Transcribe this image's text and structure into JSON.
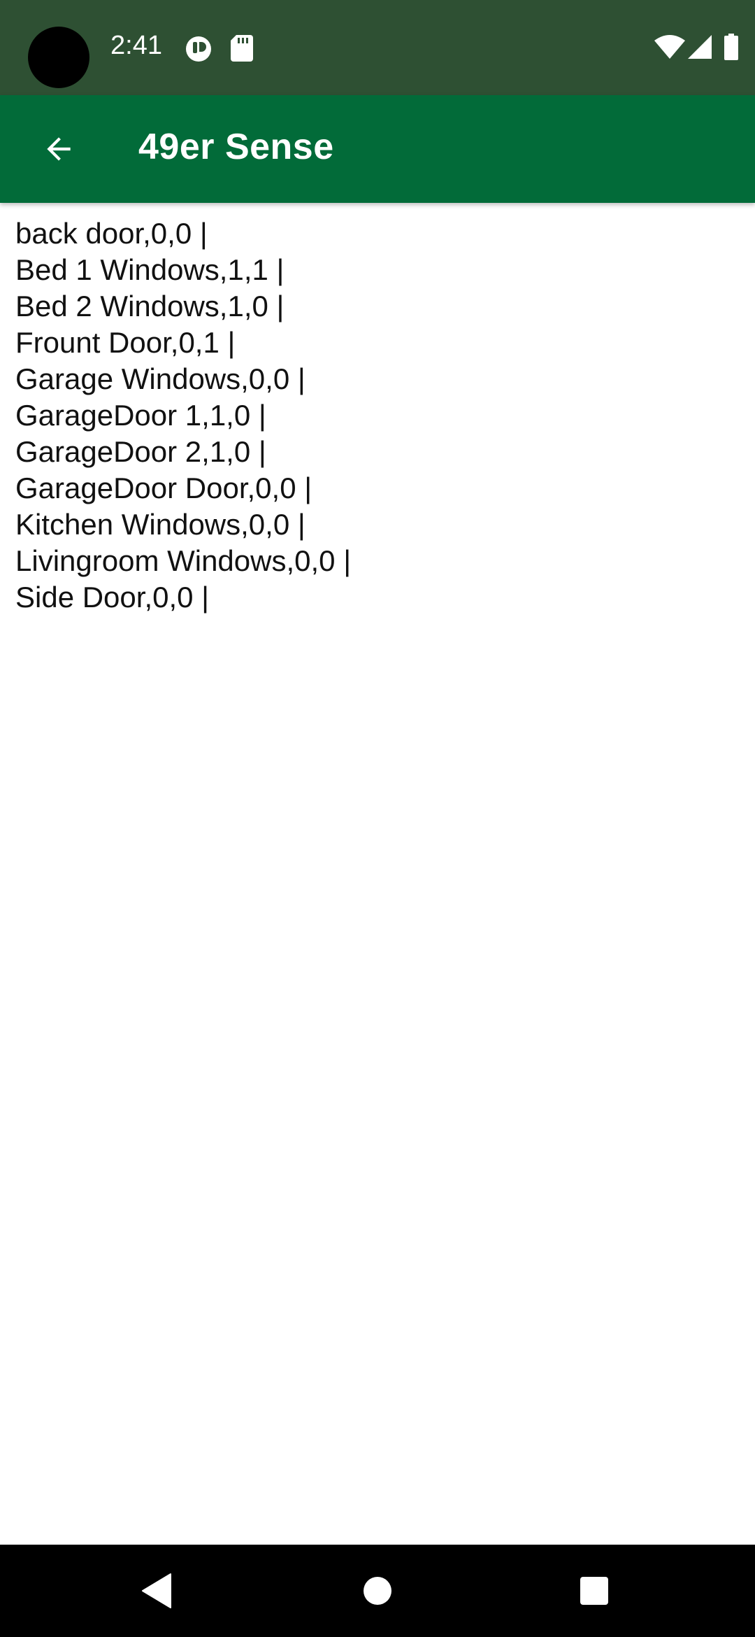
{
  "status_bar": {
    "time": "2:41",
    "left_icons": [
      "notification-icon",
      "sd-card-icon"
    ],
    "right_icons": [
      "wifi-icon",
      "cell-signal-icon",
      "battery-icon"
    ]
  },
  "app_bar": {
    "back_icon": "arrow-back-icon",
    "title": "49er Sense",
    "color": "#026b39"
  },
  "sensor_lines": [
    "back door,0,0 |",
    "Bed 1 Windows,1,1 |",
    "Bed 2 Windows,1,0 |",
    "Frount Door,0,1 |",
    "Garage Windows,0,0 |",
    "GarageDoor 1,1,0 |",
    "GarageDoor 2,1,0 |",
    "GarageDoor Door,0,0 |",
    "Kitchen Windows,0,0 |",
    "Livingroom Windows,0,0 |",
    "Side Door,0,0 |"
  ],
  "nav_bar": {
    "buttons": [
      "back-triangle-icon",
      "home-circle-icon",
      "recents-square-icon"
    ]
  }
}
